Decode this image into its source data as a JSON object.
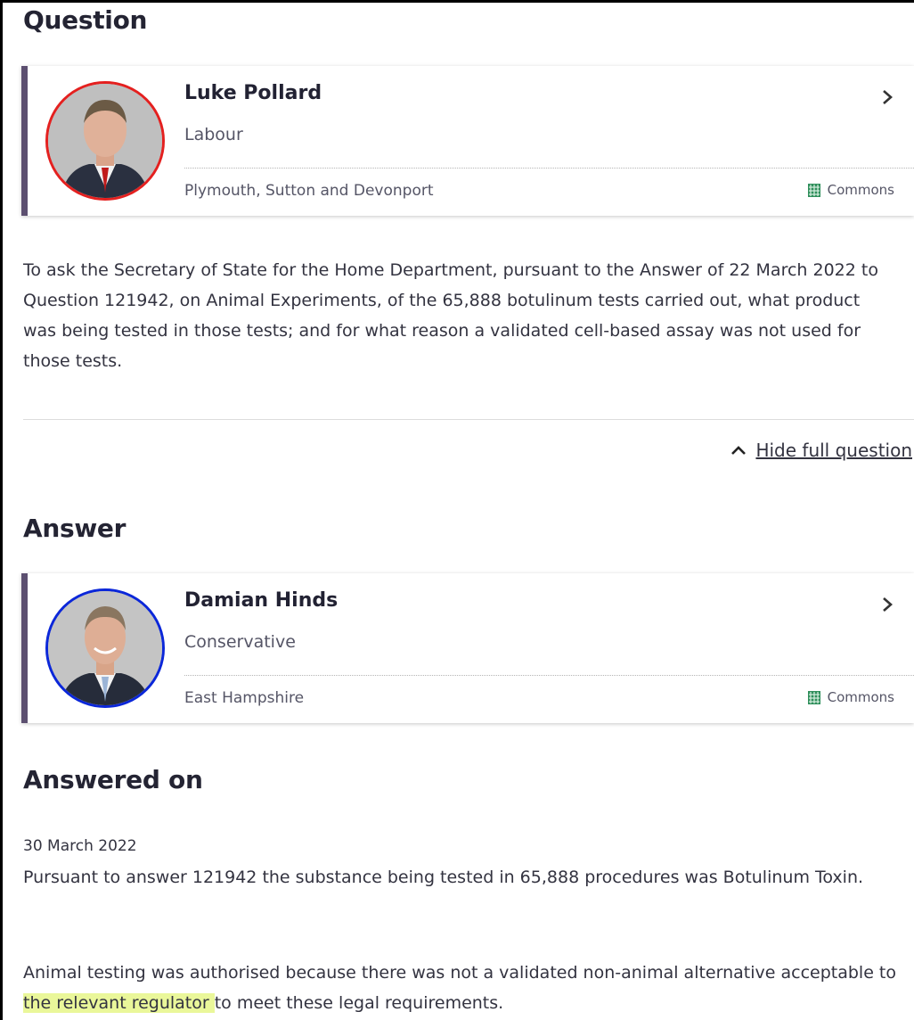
{
  "question": {
    "heading": "Question",
    "member": {
      "name": "Luke Pollard",
      "party": "Labour",
      "party_color": "#e4201f",
      "constituency": "Plymouth, Sutton and Devonport",
      "house": "Commons",
      "house_color": "#2f8f5b"
    },
    "text": "To ask the Secretary of State for the Home Department, pursuant to the Answer of 22 March 2022 to Question 121942, on Animal Experiments, of the 65,888 botulinum tests carried out, what product was being tested in those tests; and for what reason a validated cell-based assay was not used for those tests.",
    "toggle_label": "Hide full question",
    "toggle_icon": "chevron-up-icon"
  },
  "answer": {
    "heading": "Answer",
    "member": {
      "name": "Damian Hinds",
      "party": "Conservative",
      "party_color": "#0b27d9",
      "constituency": "East Hampshire",
      "house": "Commons",
      "house_color": "#2f8f5b"
    }
  },
  "answered_on": {
    "heading": "Answered on",
    "date": "30 March 2022",
    "paragraph_1": "Pursuant to answer 121942 the substance being tested in 65,888 procedures was Botulinum Toxin.",
    "paragraph_2_before": "Animal testing was authorised because there was not a validated non-animal alternative acceptable to ",
    "paragraph_2_highlight": "the relevant regulator ",
    "paragraph_2_after": "to meet these legal requirements.",
    "highlight_color": "#eaf79a"
  },
  "accent_color": "#5c4f70"
}
